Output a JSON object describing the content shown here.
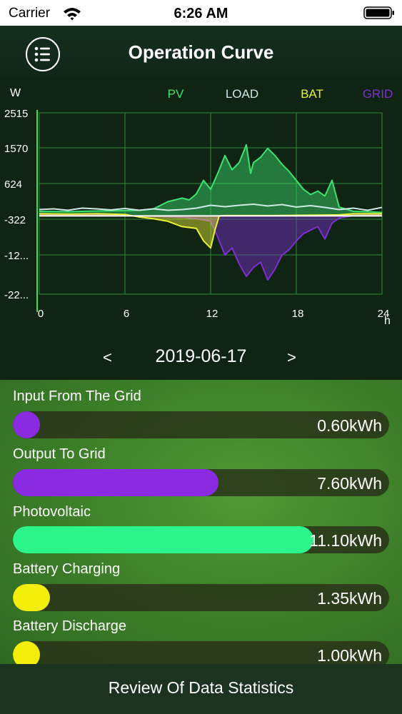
{
  "status": {
    "carrier": "Carrier",
    "time": "6:26 AM"
  },
  "header": {
    "title": "Operation Curve",
    "menu_icon": "list-icon"
  },
  "chart_data": {
    "type": "area",
    "ylabel": "W",
    "xlabel": "h",
    "x_ticks": [
      "0",
      "6",
      "12",
      "18",
      "24"
    ],
    "y_ticks": [
      "2515",
      "1570",
      "624",
      "-322",
      "-12...",
      "-22..."
    ],
    "xlim": [
      0,
      24
    ],
    "ylim": [
      -2200,
      2900
    ],
    "grid": true,
    "legend_position": "top",
    "series": [
      {
        "name": "PV",
        "color": "#3de26f",
        "fill": true,
        "points": [
          [
            0,
            130
          ],
          [
            2,
            120
          ],
          [
            4,
            140
          ],
          [
            6,
            150
          ],
          [
            7,
            160
          ],
          [
            8,
            200
          ],
          [
            9,
            400
          ],
          [
            10,
            500
          ],
          [
            10.5,
            450
          ],
          [
            11,
            620
          ],
          [
            11.5,
            1000
          ],
          [
            12,
            750
          ],
          [
            12.5,
            1200
          ],
          [
            13,
            1700
          ],
          [
            13.5,
            1300
          ],
          [
            14,
            1500
          ],
          [
            14.5,
            2000
          ],
          [
            14.8,
            1200
          ],
          [
            15,
            1500
          ],
          [
            15.5,
            1650
          ],
          [
            16,
            1900
          ],
          [
            16.5,
            1700
          ],
          [
            17,
            1450
          ],
          [
            17.5,
            1250
          ],
          [
            18,
            1000
          ],
          [
            18.5,
            750
          ],
          [
            19,
            600
          ],
          [
            19.5,
            700
          ],
          [
            20,
            560
          ],
          [
            20.5,
            1000
          ],
          [
            21,
            250
          ],
          [
            22,
            130
          ],
          [
            23,
            120
          ],
          [
            24,
            100
          ]
        ]
      },
      {
        "name": "LOAD",
        "color": "#cfe8e6",
        "fill": false,
        "points": [
          [
            0,
            180
          ],
          [
            1,
            200
          ],
          [
            2,
            160
          ],
          [
            3,
            220
          ],
          [
            4,
            200
          ],
          [
            5,
            170
          ],
          [
            6,
            210
          ],
          [
            7,
            160
          ],
          [
            8,
            200
          ],
          [
            9,
            160
          ],
          [
            10,
            180
          ],
          [
            11,
            220
          ],
          [
            12,
            300
          ],
          [
            13,
            260
          ],
          [
            14,
            300
          ],
          [
            15,
            330
          ],
          [
            16,
            280
          ],
          [
            17,
            320
          ],
          [
            18,
            250
          ],
          [
            19,
            290
          ],
          [
            20,
            240
          ],
          [
            21,
            180
          ],
          [
            22,
            220
          ],
          [
            23,
            160
          ],
          [
            24,
            240
          ]
        ]
      },
      {
        "name": "BAT",
        "color": "#eaf035",
        "fill": true,
        "points": [
          [
            0,
            60
          ],
          [
            2,
            50
          ],
          [
            4,
            60
          ],
          [
            6,
            40
          ],
          [
            7,
            -30
          ],
          [
            8,
            -80
          ],
          [
            9,
            -150
          ],
          [
            10,
            -300
          ],
          [
            11,
            -350
          ],
          [
            11.5,
            -700
          ],
          [
            12,
            -900
          ],
          [
            12.3,
            -400
          ],
          [
            12.6,
            0
          ],
          [
            13,
            10
          ],
          [
            16,
            10
          ],
          [
            19,
            20
          ],
          [
            21,
            30
          ],
          [
            22,
            60
          ],
          [
            24,
            60
          ]
        ]
      },
      {
        "name": "GRID",
        "color": "#7e2fd0",
        "fill": true,
        "points": [
          [
            0,
            20
          ],
          [
            2,
            25
          ],
          [
            4,
            20
          ],
          [
            6,
            10
          ],
          [
            8,
            -10
          ],
          [
            10,
            -40
          ],
          [
            11,
            -80
          ],
          [
            12,
            -150
          ],
          [
            12.5,
            -600
          ],
          [
            13,
            -1100
          ],
          [
            13.5,
            -900
          ],
          [
            14,
            -1350
          ],
          [
            14.5,
            -1700
          ],
          [
            15,
            -1450
          ],
          [
            15.5,
            -1300
          ],
          [
            16,
            -1800
          ],
          [
            16.5,
            -1500
          ],
          [
            17,
            -1100
          ],
          [
            17.5,
            -950
          ],
          [
            18,
            -700
          ],
          [
            18.5,
            -500
          ],
          [
            19,
            -400
          ],
          [
            19.5,
            -300
          ],
          [
            20,
            -650
          ],
          [
            20.5,
            -200
          ],
          [
            21,
            -60
          ],
          [
            22,
            10
          ],
          [
            24,
            20
          ]
        ]
      }
    ]
  },
  "date_nav": {
    "prev": "<",
    "date": "2019-06-17",
    "next": ">"
  },
  "stats": [
    {
      "label": "Input From The Grid",
      "value": "0.60kWh",
      "fraction": 0.045,
      "color": "#8a2be2"
    },
    {
      "label": "Output To Grid",
      "value": "7.60kWh",
      "fraction": 0.547,
      "color": "#8a2be2"
    },
    {
      "label": "Photovoltaic",
      "value": "11.10kWh",
      "fraction": 0.798,
      "color": "#2cf58c"
    },
    {
      "label": "Battery Charging",
      "value": "1.35kWh",
      "fraction": 0.098,
      "color": "#f3ee0a"
    },
    {
      "label": "Battery Discharge",
      "value": "1.00kWh",
      "fraction": 0.072,
      "color": "#f3ee0a"
    }
  ],
  "footer": {
    "label": "Review Of Data Statistics"
  }
}
